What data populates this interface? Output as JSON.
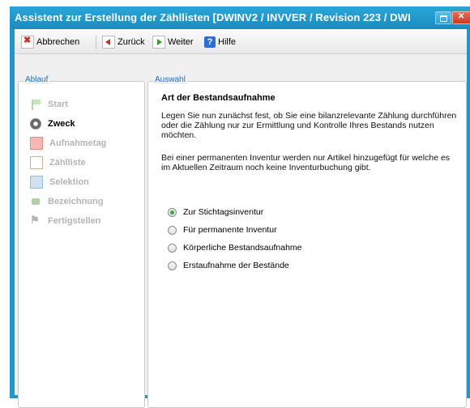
{
  "window": {
    "title": "Assistent zur Erstellung der Zähllisten [DWINV2 / INVVER / Revision 223 / DWI"
  },
  "toolbar": {
    "cancel_label": "Abbrechen",
    "back_label": "Zurück",
    "next_label": "Weiter",
    "help_label": "Hilfe"
  },
  "steps_panel": {
    "legend": "Ablauf",
    "items": [
      {
        "label": "Start",
        "icon": "flag-icon",
        "active": false
      },
      {
        "label": "Zweck",
        "icon": "gear-icon",
        "active": true
      },
      {
        "label": "Aufnahmetag",
        "icon": "calendar-icon",
        "active": false
      },
      {
        "label": "Zählliste",
        "icon": "document-icon",
        "active": false
      },
      {
        "label": "Selektion",
        "icon": "selection-icon",
        "active": false
      },
      {
        "label": "Bezeichnung",
        "icon": "tag-icon",
        "active": false
      },
      {
        "label": "Fertigstellen",
        "icon": "finish-icon",
        "active": false
      }
    ]
  },
  "content": {
    "legend": "Auswahl",
    "heading": "Art der Bestandsaufnahme",
    "paragraph1": "Legen Sie nun zunächst fest, ob Sie eine bilanzrelevante Zählung durchführen oder die Zählung nur zur Ermittlung und Kontrolle Ihres Bestands nutzen möchten.",
    "paragraph2": "Bei einer permanenten Inventur werden nur Artikel hinzugefügt für welche es im Aktuellen Zeitraum noch keine Inventurbuchung gibt.",
    "options": [
      {
        "label": "Zur Stichtagsinventur",
        "selected": true
      },
      {
        "label": "Für permanente Inventur",
        "selected": false
      },
      {
        "label": "Körperliche Bestandsaufnahme",
        "selected": false
      },
      {
        "label": "Erstaufnahme der Bestände",
        "selected": false
      }
    ]
  },
  "colors": {
    "titlebar": "#1a8bbf",
    "legend_text": "#1f6fb5",
    "radio_selected": "#33a733"
  }
}
